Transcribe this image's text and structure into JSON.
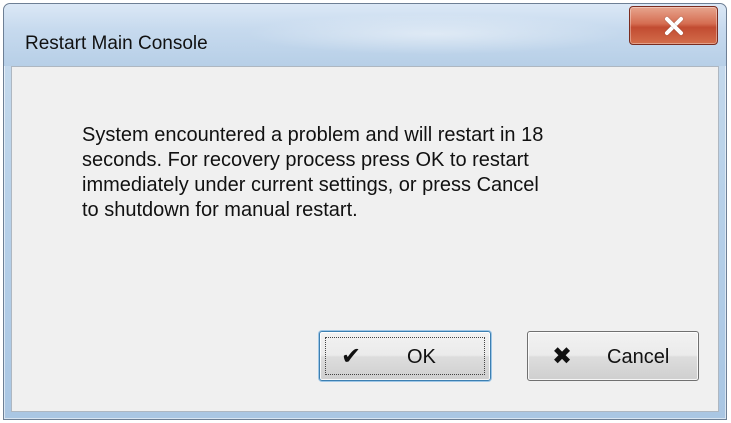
{
  "window": {
    "title": "Restart Main Console"
  },
  "dialog": {
    "message_lines": [
      "System encountered a problem and will restart in 18",
      "seconds. For recovery process press OK to restart",
      "immediately under current settings, or press Cancel",
      "to shutdown for manual restart."
    ],
    "ok_label": "OK",
    "cancel_label": "Cancel"
  },
  "icons": {
    "ok": "check-icon",
    "cancel": "x-icon",
    "close": "close-icon"
  },
  "colors": {
    "titlebar": "#c7daee",
    "client": "#f0f0f0",
    "close_button": "#d56d51",
    "ok_focus": "#3c7fb1"
  }
}
